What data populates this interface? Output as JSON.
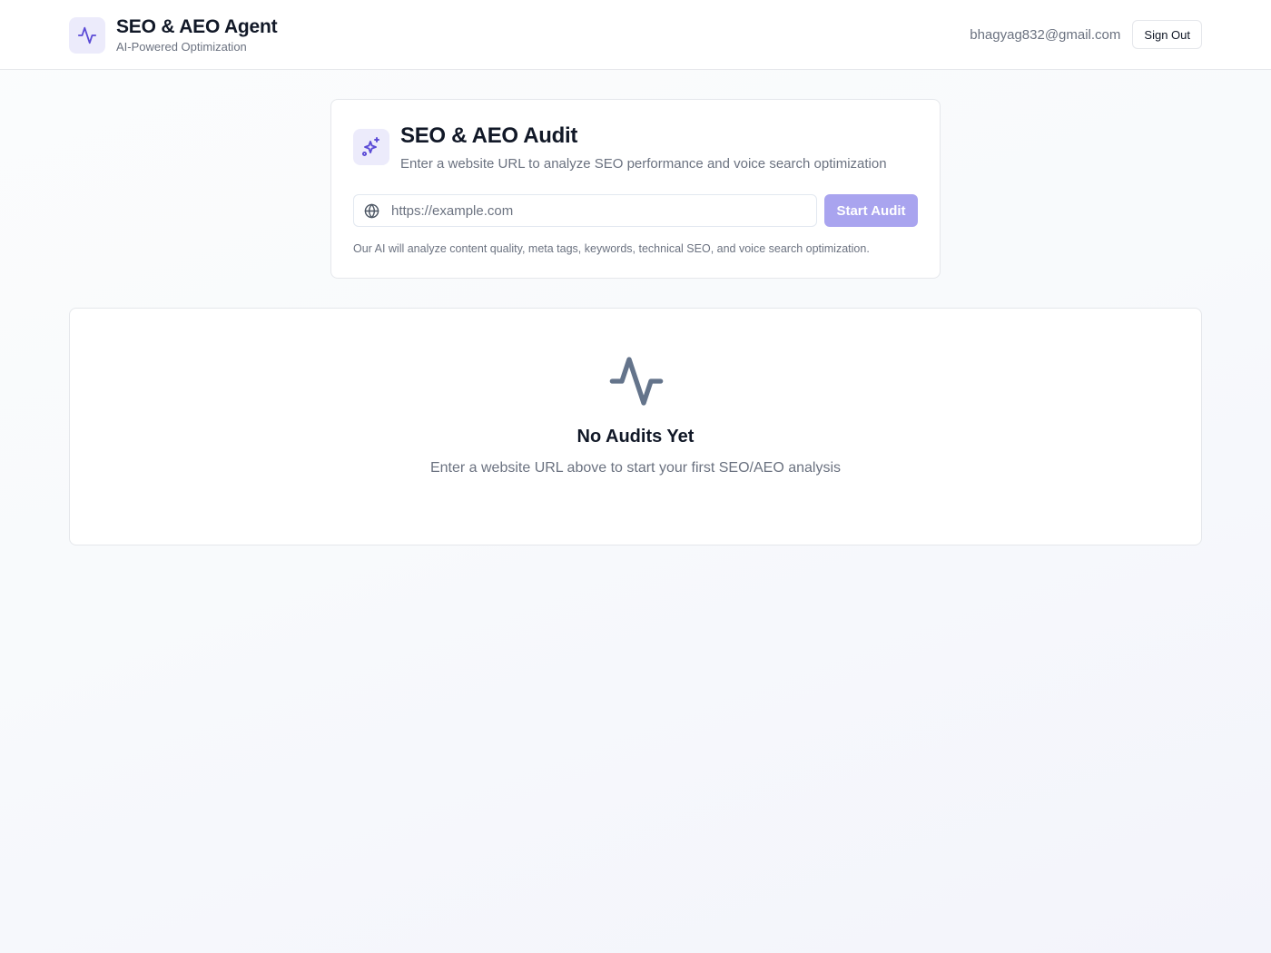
{
  "header": {
    "title": "SEO & AEO Agent",
    "subtitle": "AI-Powered Optimization",
    "logo_icon": "activity-icon",
    "user_email": "bhagyag832@gmail.com",
    "sign_out_label": "Sign Out"
  },
  "audit": {
    "icon": "sparkles-icon",
    "title": "SEO & AEO Audit",
    "description": "Enter a website URL to analyze SEO performance and voice search optimization",
    "url_placeholder": "https://example.com",
    "url_value": "",
    "input_icon": "globe-icon",
    "start_label": "Start Audit",
    "note": "Our AI will analyze content quality, meta tags, keywords, technical SEO, and voice search optimization."
  },
  "empty_state": {
    "icon": "activity-icon",
    "title": "No Audits Yet",
    "description": "Enter a website URL above to start your first SEO/AEO analysis"
  },
  "colors": {
    "accent": "#5b4bd6",
    "accent_disabled": "#a9a4ef",
    "icon_bg": "#ecebfb",
    "muted_text": "#6b7280",
    "border": "#e5e7eb"
  }
}
